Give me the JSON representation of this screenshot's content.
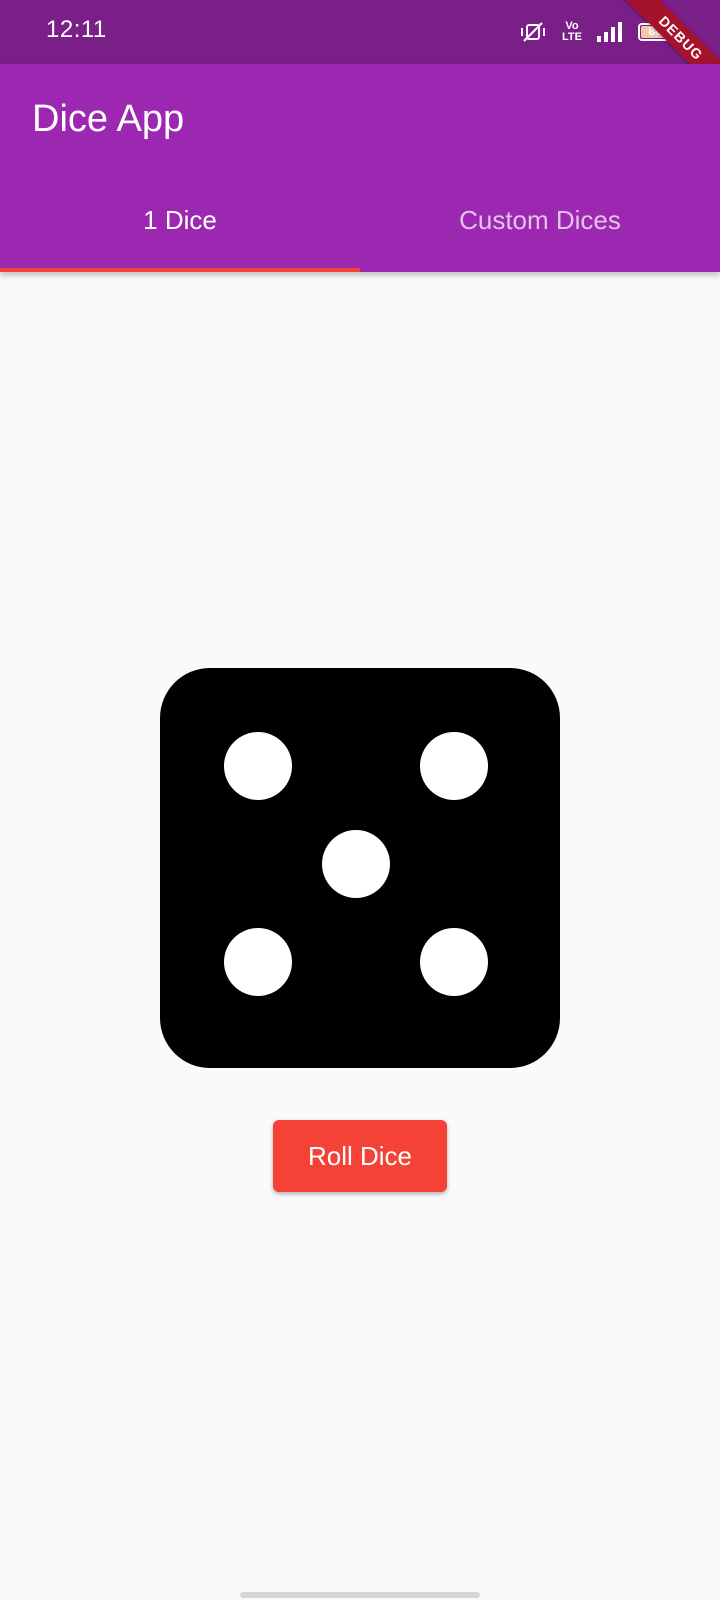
{
  "status_bar": {
    "time": "12:11",
    "icons": [
      "vibrate-icon",
      "volte-icon",
      "signal-icon",
      "battery-icon"
    ],
    "volte_text": "Vo\nLTE",
    "battery_level": "88",
    "debug_banner": "DEBUG"
  },
  "app_bar": {
    "title": "Dice App",
    "background_color": "#9c27b0"
  },
  "tabs": [
    {
      "label": "1 Dice",
      "selected": true
    },
    {
      "label": "Custom Dices",
      "selected": false
    }
  ],
  "tab_indicator_color": "#f44336",
  "dice": {
    "face_value": 5,
    "face_color": "#000000",
    "pip_color": "#ffffff"
  },
  "roll_button": {
    "label": "Roll Dice",
    "color": "#f44336"
  }
}
